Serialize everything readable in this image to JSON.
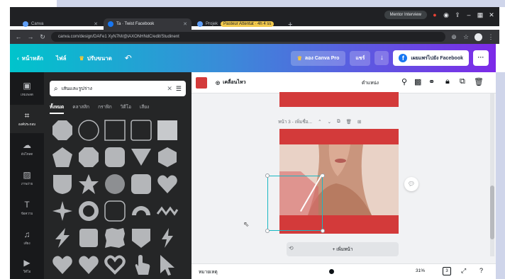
{
  "meeting_bar": {
    "status_label": "Mentor Interview"
  },
  "browser": {
    "tabs": [
      {
        "title": "Canva"
      },
      {
        "title": "Ta · Twist Facebook"
      },
      {
        "title": "Projek"
      }
    ],
    "active_tab_badge": "Pasteur Attentat · 4h 4 ss",
    "new_tab": "+",
    "url": "canva.com/design/DAFe1 XyN7M/@iAXONHNdC/edit/Studinent"
  },
  "canva_top": {
    "back_label": "หน้าหลัก",
    "file_label": "ไฟล์",
    "resize_label": "ปรับขนาด",
    "pro_label": "ลอง Canva Pro",
    "share_label": "แชร์",
    "facebook_label": "เผยแพร่ไปยัง Facebook",
    "more_label": "···"
  },
  "rail": {
    "items": [
      {
        "label": "เทมเพลต",
        "icon": "template-icon"
      },
      {
        "label": "องค์ประกอบ",
        "icon": "elements-icon"
      },
      {
        "label": "อัปโหลด",
        "icon": "upload-icon"
      },
      {
        "label": "ภาพถ่าย",
        "icon": "photos-icon"
      },
      {
        "label": "ข้อความ",
        "icon": "text-icon"
      },
      {
        "label": "เสียง",
        "icon": "audio-icon"
      },
      {
        "label": "วิดีโอ",
        "icon": "video-icon"
      }
    ]
  },
  "panel": {
    "search_value": "เส้นและรูปร่าง",
    "tabs": [
      "ทั้งหมด",
      "คลาสสิก",
      "กราฟิก",
      "วิดีโอ",
      "เสียง"
    ]
  },
  "toolbar": {
    "animate_label": "เคลื่อนไหว",
    "position_label": "ตำแหน่ง"
  },
  "editor": {
    "page_label": "หน้า 3 - เพิ่มชื่อ...",
    "add_page_label": "+ เพิ่มหน้า",
    "notes_label": "หมายเหตุ",
    "zoom_value": "31%",
    "page_count": "3"
  },
  "colors": {
    "accent_red": "#d33a3a",
    "selection": "#19b8c3",
    "panel_bg": "#252627",
    "rail_bg": "#18191b"
  }
}
